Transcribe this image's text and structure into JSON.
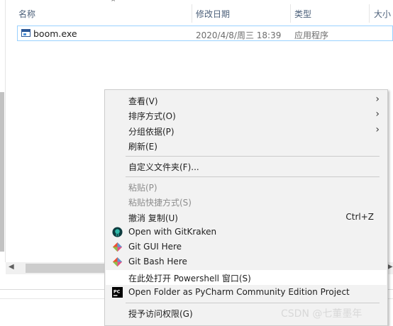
{
  "columns": {
    "name": "名称",
    "date": "修改日期",
    "type": "类型",
    "size": "大小"
  },
  "file": {
    "name": "boom.exe",
    "date": "2020/4/8/周三 18:39",
    "type": "应用程序",
    "icon": "exe-file-icon"
  },
  "context_menu": {
    "items": [
      {
        "label": "查看(V)",
        "submenu": true
      },
      {
        "label": "排序方式(O)",
        "submenu": true
      },
      {
        "label": "分组依据(P)",
        "submenu": true
      },
      {
        "label": "刷新(E)"
      },
      {
        "label": "自定义文件夹(F)..."
      },
      {
        "label": "粘贴(P)",
        "disabled": true
      },
      {
        "label": "粘贴快捷方式(S)",
        "disabled": true
      },
      {
        "label": "撤消 复制(U)",
        "shortcut": "Ctrl+Z"
      },
      {
        "label": "Open with GitKraken",
        "icon": "gitkraken-icon"
      },
      {
        "label": "Git GUI Here",
        "icon": "git-icon"
      },
      {
        "label": "Git Bash Here",
        "icon": "git-icon"
      },
      {
        "label": "在此处打开 Powershell 窗口(S)"
      },
      {
        "label": "Open Folder as PyCharm Community Edition Project",
        "icon": "pycharm-icon"
      },
      {
        "label": "授予访问权限(G)"
      }
    ]
  },
  "watermark": "CSDN @七董墨年",
  "colors": {
    "menu_bg": "#f2f2f2",
    "selection_border": "#99d1ff",
    "header_text": "#4c607a"
  }
}
